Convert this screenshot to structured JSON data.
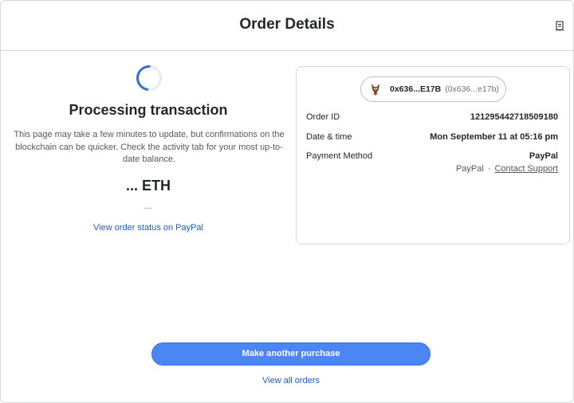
{
  "header": {
    "title": "Order Details",
    "icon": "receipt-icon"
  },
  "status": {
    "title": "Processing transaction",
    "description": "This page may take a few minutes to update, but confirmations on the blockchain can be quicker. Check the activity tab for your most up-to-date balance.",
    "amount": "... ETH",
    "amount_sub": "...",
    "link": "View order status on PayPal"
  },
  "account": {
    "short": "0x636...E17B",
    "alt": "(0x636...e17b)",
    "avatar_icon": "fox-avatar-icon"
  },
  "details": {
    "order_id_label": "Order ID",
    "order_id": "121295442718509180",
    "date_label": "Date & time",
    "date": "Mon September 11 at 05:16 pm",
    "payment_label": "Payment Method",
    "payment": "PayPal",
    "provider": "PayPal",
    "separator": "·",
    "support": "Contact Support"
  },
  "actions": {
    "primary": "Make another purchase",
    "secondary": "View all orders"
  },
  "colors": {
    "accent": "#4c86f4",
    "link": "#1c5cc8",
    "border": "#d6d9dc"
  }
}
